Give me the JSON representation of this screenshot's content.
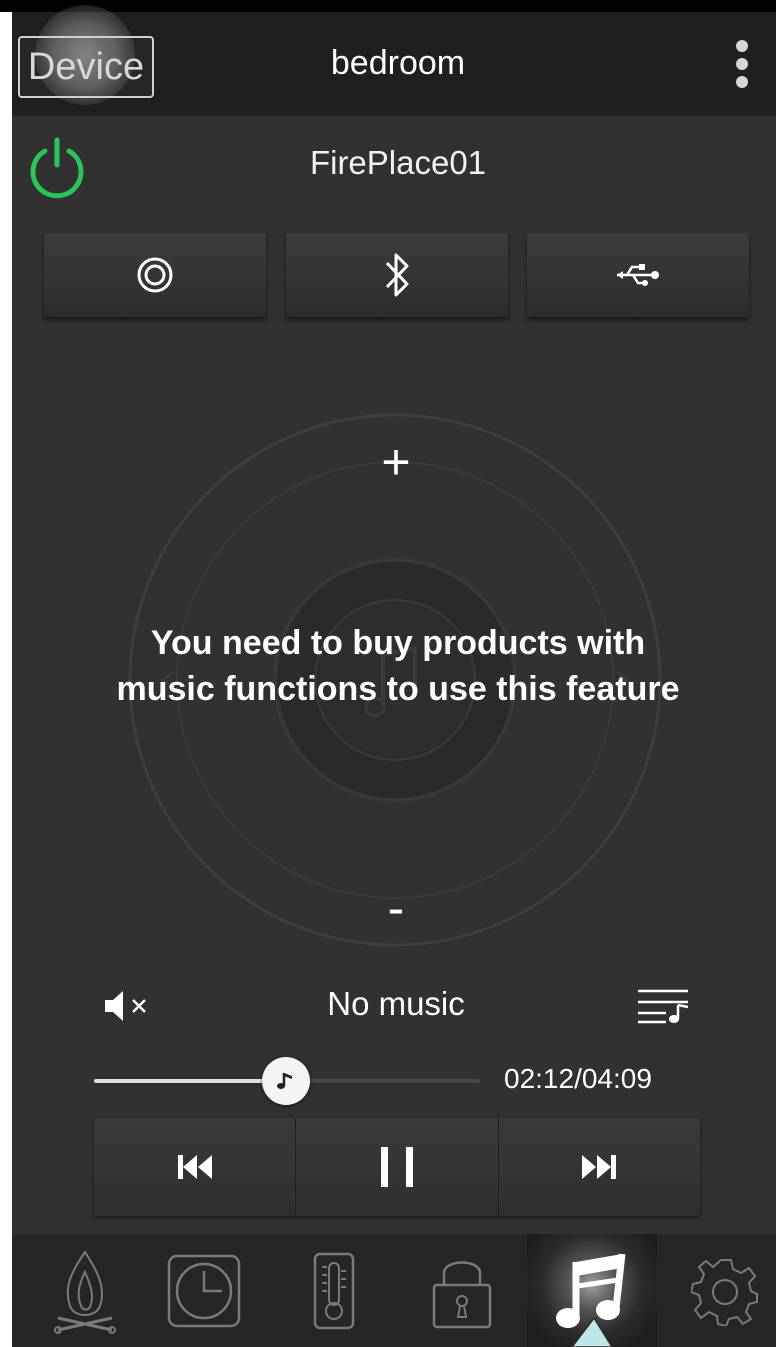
{
  "header": {
    "back_label": "Device",
    "title": "bedroom",
    "more_icon": "more-vertical-icon"
  },
  "device": {
    "name": "FirePlace01",
    "power_icon": "power-icon",
    "power_color": "#2bc45a"
  },
  "sources": [
    {
      "icon": "radio-icon"
    },
    {
      "icon": "bluetooth-icon"
    },
    {
      "icon": "usb-icon"
    }
  ],
  "volume": {
    "plus_label": "+",
    "minus_label": "-"
  },
  "notice": {
    "line1": "You need to buy products with",
    "line2": "music functions to use this feature"
  },
  "player": {
    "now_playing": "No music",
    "time": "02:12/04:09",
    "progress_fraction": 0.54,
    "mute_icon": "mute-icon",
    "playlist_icon": "playlist-icon"
  },
  "controls": [
    "previous-icon",
    "pause-icon",
    "next-icon"
  ],
  "tabs": [
    {
      "name": "fire",
      "icon": "flame-icon",
      "active": false
    },
    {
      "name": "timer",
      "icon": "clock-icon",
      "active": false
    },
    {
      "name": "temperature",
      "icon": "thermometer-icon",
      "active": false
    },
    {
      "name": "lock",
      "icon": "lock-icon",
      "active": false
    },
    {
      "name": "music",
      "icon": "music-note-icon",
      "active": true
    },
    {
      "name": "settings",
      "icon": "gear-icon",
      "active": false
    }
  ],
  "colors": {
    "background": "#313131",
    "header": "#1f1f1f",
    "tabbar": "#262626",
    "power_green": "#2bc45a",
    "tap_indicator": "#bfe7ea"
  }
}
